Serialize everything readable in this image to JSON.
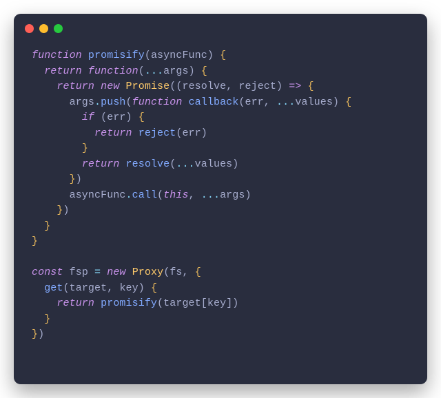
{
  "window": {
    "traffic_light_colors": {
      "close": "#ff5f56",
      "minimize": "#ffbd2e",
      "zoom": "#27c93f"
    }
  },
  "code": {
    "lines": [
      [
        {
          "t": "function",
          "c": "kw"
        },
        {
          "t": " "
        },
        {
          "t": "promisify",
          "c": "fnid"
        },
        {
          "t": "("
        },
        {
          "t": "asyncFunc",
          "c": "par"
        },
        {
          "t": ")"
        },
        {
          "t": " "
        },
        {
          "t": "{",
          "c": "pun"
        }
      ],
      [
        {
          "t": "  "
        },
        {
          "t": "return",
          "c": "kw"
        },
        {
          "t": " "
        },
        {
          "t": "function",
          "c": "kw"
        },
        {
          "t": "("
        },
        {
          "t": "...",
          "c": "op"
        },
        {
          "t": "args",
          "c": "par"
        },
        {
          "t": ")"
        },
        {
          "t": " "
        },
        {
          "t": "{",
          "c": "pun"
        }
      ],
      [
        {
          "t": "    "
        },
        {
          "t": "return",
          "c": "kw"
        },
        {
          "t": " "
        },
        {
          "t": "new",
          "c": "kw"
        },
        {
          "t": " "
        },
        {
          "t": "Promise",
          "c": "cls"
        },
        {
          "t": "(("
        },
        {
          "t": "resolve",
          "c": "par"
        },
        {
          "t": ", "
        },
        {
          "t": "reject",
          "c": "par"
        },
        {
          "t": ")"
        },
        {
          "t": " "
        },
        {
          "t": "=>",
          "c": "arrw"
        },
        {
          "t": " "
        },
        {
          "t": "{",
          "c": "pun"
        }
      ],
      [
        {
          "t": "      "
        },
        {
          "t": "args",
          "c": "par"
        },
        {
          "t": ".",
          "c": "op"
        },
        {
          "t": "push",
          "c": "fnid"
        },
        {
          "t": "("
        },
        {
          "t": "function",
          "c": "kw"
        },
        {
          "t": " "
        },
        {
          "t": "callback",
          "c": "fnid"
        },
        {
          "t": "("
        },
        {
          "t": "err",
          "c": "par"
        },
        {
          "t": ", "
        },
        {
          "t": "...",
          "c": "op"
        },
        {
          "t": "values",
          "c": "par"
        },
        {
          "t": ")"
        },
        {
          "t": " "
        },
        {
          "t": "{",
          "c": "pun"
        }
      ],
      [
        {
          "t": "        "
        },
        {
          "t": "if",
          "c": "kw"
        },
        {
          "t": " ("
        },
        {
          "t": "err",
          "c": "par"
        },
        {
          "t": ")"
        },
        {
          "t": " "
        },
        {
          "t": "{",
          "c": "pun"
        }
      ],
      [
        {
          "t": "          "
        },
        {
          "t": "return",
          "c": "kw"
        },
        {
          "t": " "
        },
        {
          "t": "reject",
          "c": "fnid"
        },
        {
          "t": "("
        },
        {
          "t": "err",
          "c": "par"
        },
        {
          "t": ")"
        }
      ],
      [
        {
          "t": "        "
        },
        {
          "t": "}",
          "c": "pun"
        }
      ],
      [
        {
          "t": "        "
        },
        {
          "t": "return",
          "c": "kw"
        },
        {
          "t": " "
        },
        {
          "t": "resolve",
          "c": "fnid"
        },
        {
          "t": "("
        },
        {
          "t": "...",
          "c": "op"
        },
        {
          "t": "values",
          "c": "par"
        },
        {
          "t": ")"
        }
      ],
      [
        {
          "t": "      "
        },
        {
          "t": "}",
          "c": "pun"
        },
        {
          "t": ")"
        }
      ],
      [
        {
          "t": "      "
        },
        {
          "t": "asyncFunc",
          "c": "par"
        },
        {
          "t": ".",
          "c": "op"
        },
        {
          "t": "call",
          "c": "fnid"
        },
        {
          "t": "("
        },
        {
          "t": "this",
          "c": "kw"
        },
        {
          "t": ", "
        },
        {
          "t": "...",
          "c": "op"
        },
        {
          "t": "args",
          "c": "par"
        },
        {
          "t": ")"
        }
      ],
      [
        {
          "t": "    "
        },
        {
          "t": "}",
          "c": "pun"
        },
        {
          "t": ")"
        }
      ],
      [
        {
          "t": "  "
        },
        {
          "t": "}",
          "c": "pun"
        }
      ],
      [
        {
          "t": "}",
          "c": "pun"
        }
      ],
      [
        {
          "t": ""
        }
      ],
      [
        {
          "t": "const",
          "c": "kw"
        },
        {
          "t": " "
        },
        {
          "t": "fsp",
          "c": "par"
        },
        {
          "t": " "
        },
        {
          "t": "=",
          "c": "op"
        },
        {
          "t": " "
        },
        {
          "t": "new",
          "c": "kw"
        },
        {
          "t": " "
        },
        {
          "t": "Proxy",
          "c": "cls"
        },
        {
          "t": "("
        },
        {
          "t": "fs",
          "c": "par"
        },
        {
          "t": ", "
        },
        {
          "t": "{",
          "c": "pun"
        }
      ],
      [
        {
          "t": "  "
        },
        {
          "t": "get",
          "c": "fnid"
        },
        {
          "t": "("
        },
        {
          "t": "target",
          "c": "par"
        },
        {
          "t": ", "
        },
        {
          "t": "key",
          "c": "par"
        },
        {
          "t": ")"
        },
        {
          "t": " "
        },
        {
          "t": "{",
          "c": "pun"
        }
      ],
      [
        {
          "t": "    "
        },
        {
          "t": "return",
          "c": "kw"
        },
        {
          "t": " "
        },
        {
          "t": "promisify",
          "c": "fnid"
        },
        {
          "t": "("
        },
        {
          "t": "target",
          "c": "par"
        },
        {
          "t": "["
        },
        {
          "t": "key",
          "c": "par"
        },
        {
          "t": "])"
        }
      ],
      [
        {
          "t": "  "
        },
        {
          "t": "}",
          "c": "pun"
        }
      ],
      [
        {
          "t": "}",
          "c": "pun"
        },
        {
          "t": ")"
        }
      ]
    ]
  }
}
